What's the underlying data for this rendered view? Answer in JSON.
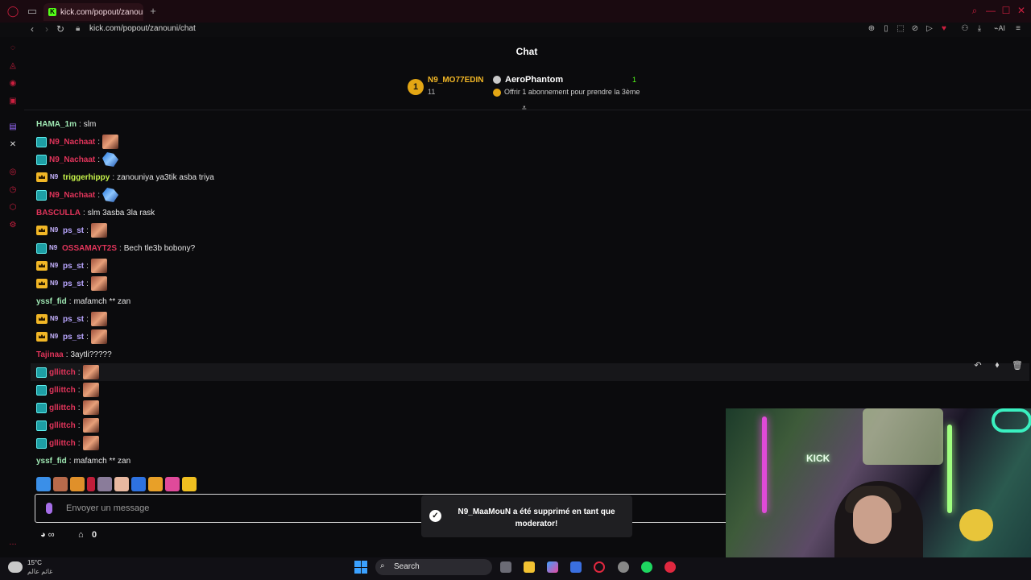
{
  "browser": {
    "tab_title": "kick.com/popout/zanouni/",
    "url": "kick.com/popout/zanouni/chat",
    "new_tab": "+"
  },
  "chat": {
    "title": "Chat",
    "leaderboard": {
      "first": {
        "rank": "1",
        "name": "N9_MO77EDIN",
        "count": "11"
      },
      "second": {
        "name": "AeroPhantom",
        "count": "1",
        "subtitle": "Offrir 1 abonnement pour prendre la 3ème"
      }
    },
    "messages": [
      {
        "user": "HAMA_1m",
        "color": "#9fe8b3",
        "badges": [],
        "text": "slm",
        "emote": ""
      },
      {
        "user": "N9_Nachaat",
        "color": "#e0345a",
        "badges": [
          "sub"
        ],
        "text": "",
        "emote": "face"
      },
      {
        "user": "N9_Nachaat",
        "color": "#e0345a",
        "badges": [
          "sub"
        ],
        "text": "",
        "emote": "blue"
      },
      {
        "user": "triggerhippy",
        "color": "#c6f24a",
        "badges": [
          "crown",
          "n9"
        ],
        "text": "zanouniya ya3tik asba triya",
        "emote": ""
      },
      {
        "user": "N9_Nachaat",
        "color": "#e0345a",
        "badges": [
          "sub"
        ],
        "text": "",
        "emote": "blue"
      },
      {
        "user": "BASCULLA",
        "color": "#e0345a",
        "badges": [],
        "text": "slm 3asba 3la rask",
        "emote": ""
      },
      {
        "user": "ps_st",
        "color": "#b9a6ff",
        "badges": [
          "crown",
          "n9"
        ],
        "text": "",
        "emote": "face"
      },
      {
        "user": "OSSAMAYT2S",
        "color": "#e0345a",
        "badges": [
          "sub",
          "n9"
        ],
        "text": "Bech tle3b bobony?",
        "emote": ""
      },
      {
        "user": "ps_st",
        "color": "#b9a6ff",
        "badges": [
          "crown",
          "n9"
        ],
        "text": "",
        "emote": "face"
      },
      {
        "user": "ps_st",
        "color": "#b9a6ff",
        "badges": [
          "crown",
          "n9"
        ],
        "text": "",
        "emote": "face"
      },
      {
        "user": "yssf_fid",
        "color": "#9fe8b3",
        "badges": [],
        "text": "mafamch ** zan",
        "emote": ""
      },
      {
        "user": "ps_st",
        "color": "#b9a6ff",
        "badges": [
          "crown",
          "n9"
        ],
        "text": "",
        "emote": "face"
      },
      {
        "user": "ps_st",
        "color": "#b9a6ff",
        "badges": [
          "crown",
          "n9"
        ],
        "text": "",
        "emote": "face"
      },
      {
        "user": "Tajinaa",
        "color": "#e0345a",
        "badges": [],
        "text": "3aytli?????",
        "emote": ""
      },
      {
        "user": "gllittch",
        "color": "#e0345a",
        "badges": [
          "sub"
        ],
        "text": "",
        "emote": "face"
      },
      {
        "user": "gllittch",
        "color": "#e0345a",
        "badges": [
          "sub"
        ],
        "text": "",
        "emote": "face"
      },
      {
        "user": "gllittch",
        "color": "#e0345a",
        "badges": [
          "sub"
        ],
        "text": "",
        "emote": "face"
      },
      {
        "user": "gllittch",
        "color": "#e0345a",
        "badges": [
          "sub"
        ],
        "text": "",
        "emote": "face"
      },
      {
        "user": "gllittch",
        "color": "#e0345a",
        "badges": [
          "sub"
        ],
        "text": "",
        "emote": "face"
      },
      {
        "user": "yssf_fid",
        "color": "#9fe8b3",
        "badges": [],
        "text": "mafamch ** zan",
        "emote": ""
      }
    ],
    "input_placeholder": "Envoyer un message",
    "footer_count": "0",
    "toast": "N9_MaaMouN a été supprimé en tant que moderator!"
  },
  "webcam": {
    "sign": "KICK"
  },
  "taskbar": {
    "weather_temp": "15°C",
    "weather_sub": "غائم عالم",
    "search": "Search"
  },
  "colors": {
    "kick_green": "#53fc18",
    "accent_red": "#cc1f3f",
    "gold": "#f2b726"
  }
}
